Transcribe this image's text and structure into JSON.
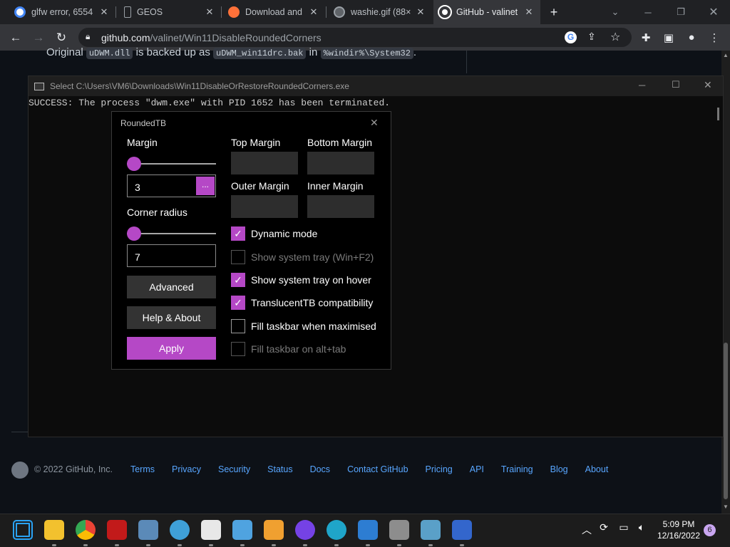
{
  "browser": {
    "tabs": [
      {
        "label": "glfw error, 6554",
        "color": "#4285f4"
      },
      {
        "label": "GEOS",
        "color": "#3c4043"
      },
      {
        "label": "Download and i",
        "color": "#ff7139"
      },
      {
        "label": "washie.gif (88×",
        "color": "#9aa0a6"
      },
      {
        "label": "GitHub - valinet",
        "color": "#ffffff"
      }
    ],
    "new_tab": "+",
    "url_host": "github.com",
    "url_path": "/valinet/Win11DisableRoundedCorners"
  },
  "page": {
    "line_prefix": "Original",
    "code1": "uDWM.dll",
    "mid1": "is backed up as",
    "code2": "uDWM_win11drc.bak",
    "mid2": "in",
    "code3": "%windir%\\System32",
    "end": "."
  },
  "footer": {
    "copyright": "© 2022 GitHub, Inc.",
    "links": [
      "Terms",
      "Privacy",
      "Security",
      "Status",
      "Docs",
      "Contact GitHub",
      "Pricing",
      "API",
      "Training",
      "Blog",
      "About"
    ]
  },
  "console": {
    "title": "Select C:\\Users\\VM6\\Downloads\\Win11DisableOrRestoreRoundedCorners.exe",
    "output": "SUCCESS: The process \"dwm.exe\" with PID 1652 has been terminated."
  },
  "roundedtb": {
    "title": "RoundedTB",
    "margin_label": "Margin",
    "margin_value": "3",
    "margin_slider": 0.0,
    "dots": "...",
    "corner_label": "Corner radius",
    "corner_value": "7",
    "corner_slider": 0.0,
    "advanced": "Advanced",
    "help": "Help & About",
    "apply": "Apply",
    "top_margin": "Top Margin",
    "bottom_margin": "Bottom Margin",
    "outer_margin": "Outer Margin",
    "inner_margin": "Inner Margin",
    "options": [
      {
        "label": "Dynamic mode",
        "checked": true,
        "disabled": false
      },
      {
        "label": "Show system tray (Win+F2)",
        "checked": false,
        "disabled": true
      },
      {
        "label": "Show system tray on hover",
        "checked": true,
        "disabled": false
      },
      {
        "label": "TranslucentTB compatibility",
        "checked": true,
        "disabled": false
      },
      {
        "label": "Fill taskbar when maximised",
        "checked": false,
        "disabled": false
      },
      {
        "label": "Fill taskbar on alt+tab",
        "checked": false,
        "disabled": true
      }
    ],
    "accent": "#b548c6"
  },
  "taskbar": {
    "time": "5:09 PM",
    "date": "12/16/2022",
    "notifications": "6",
    "apps": [
      {
        "name": "start",
        "color": "#2aa3f5"
      },
      {
        "name": "file-explorer",
        "color": "#f2c12e"
      },
      {
        "name": "chrome",
        "color": "#34a853"
      },
      {
        "name": "app-red",
        "color": "#c21a1a"
      },
      {
        "name": "photos",
        "color": "#5b8ab8"
      },
      {
        "name": "globe",
        "color": "#3fa0d8"
      },
      {
        "name": "7zip",
        "color": "#e8e8e8"
      },
      {
        "name": "notepad",
        "color": "#4fa3e0"
      },
      {
        "name": "media",
        "color": "#f0a030"
      },
      {
        "name": "firefox",
        "color": "#7542e5"
      },
      {
        "name": "edge",
        "color": "#1fa5c9"
      },
      {
        "name": "store",
        "color": "#2d7dd2"
      },
      {
        "name": "settings",
        "color": "#8d8d8d"
      },
      {
        "name": "control-panel",
        "color": "#5aa0c8"
      },
      {
        "name": "roundedtb",
        "color": "#3366cc"
      }
    ]
  }
}
